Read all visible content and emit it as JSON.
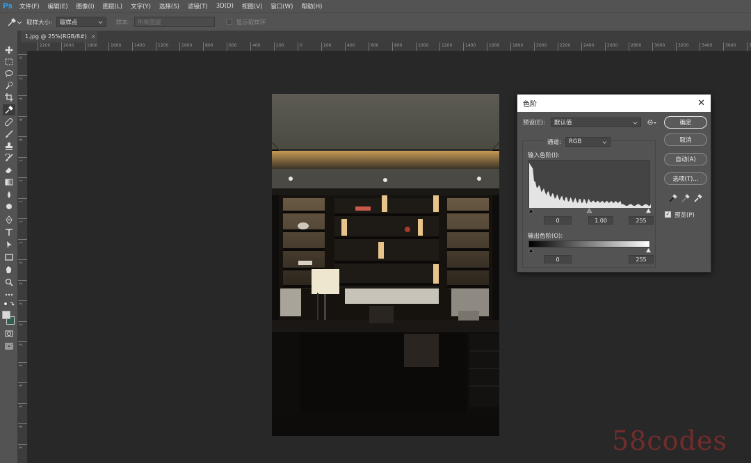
{
  "app": {
    "logo": "Ps"
  },
  "menu": [
    "文件(F)",
    "编辑(E)",
    "图像(I)",
    "图层(L)",
    "文字(Y)",
    "选择(S)",
    "滤镜(T)",
    "3D(D)",
    "视图(V)",
    "窗口(W)",
    "帮助(H)"
  ],
  "options": {
    "tool_icon": "eyedropper-icon",
    "sample_size_label": "取样大小:",
    "sample_size_value": "取样点",
    "sample_label": "样本:",
    "sample_value": "所有图层",
    "show_ring_label": "显示取样环"
  },
  "document": {
    "tab_title": "1.jpg @ 25%(RGB/8#)",
    "tab_close": "×"
  },
  "ruler": {
    "h_labels": [
      "2200",
      "2000",
      "1800",
      "1600",
      "1400",
      "1200",
      "1000",
      "800",
      "600",
      "400",
      "200",
      "0",
      "200",
      "400",
      "600",
      "800",
      "1000",
      "1200",
      "1400",
      "1600",
      "1800",
      "2000",
      "2200",
      "2400",
      "2600",
      "2800",
      "3000",
      "3200",
      "3400",
      "3600",
      "3800"
    ],
    "v_labels": [
      "0",
      "2",
      "4",
      "6",
      "8",
      "1",
      "1",
      "1",
      "1",
      "1",
      "2",
      "2",
      "2",
      "2",
      "2",
      "3",
      "3",
      "3",
      "3",
      "3"
    ]
  },
  "levels": {
    "title": "色阶",
    "close": "✕",
    "preset_label": "预设(E):",
    "preset_value": "默认值",
    "channel_label": "通道:",
    "channel_value": "RGB",
    "input_label": "输入色阶(I):",
    "input_black": "0",
    "input_gamma": "1.00",
    "input_white": "255",
    "output_label": "输出色阶(O):",
    "output_black": "0",
    "output_white": "255",
    "btn_ok": "确定",
    "btn_cancel": "取消",
    "btn_auto": "自动(A)",
    "btn_options": "选项(T)...",
    "preview_label": "预览(P)",
    "preview_checked": true
  },
  "watermark": "58codes",
  "colors": {
    "panel": "#535353",
    "canvas_bg": "#282828",
    "ps_blue": "#31a8ff",
    "foreground_swatch": "#d8d8d8",
    "background_swatch": "#2f5f50"
  }
}
